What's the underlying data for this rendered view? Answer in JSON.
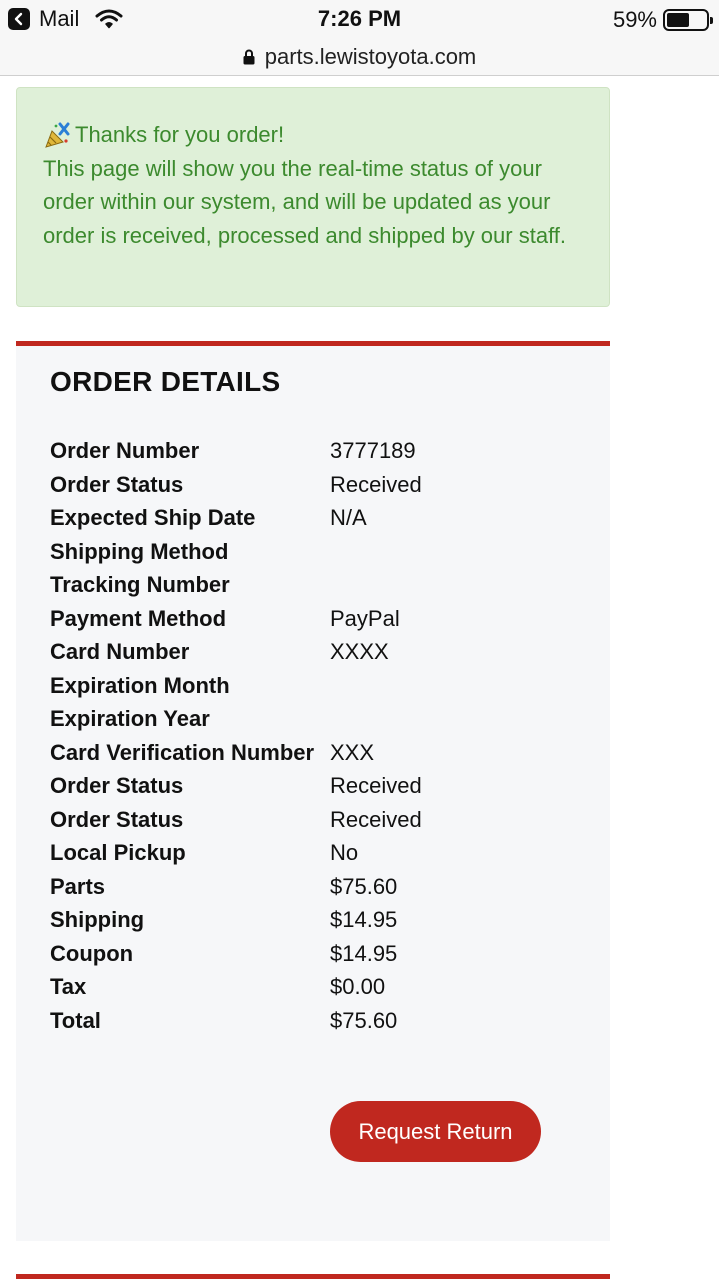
{
  "status_bar": {
    "back_app": "Mail",
    "time": "7:26 PM",
    "battery_percent_label": "59%",
    "battery_level": 0.59
  },
  "url_bar": {
    "url": "parts.lewistoyota.com"
  },
  "alert": {
    "line1": "Thanks for you order!",
    "body": "This page will show you the real-time status of your order within our system, and will be updated as your order is received, processed and shipped by our staff."
  },
  "order": {
    "title": "ORDER DETAILS",
    "rows": [
      {
        "label": "Order Number",
        "value": "3777189"
      },
      {
        "label": "Order Status",
        "value": "Received"
      },
      {
        "label": "Expected Ship Date",
        "value": "N/A"
      },
      {
        "label": "Shipping Method",
        "value": ""
      },
      {
        "label": "Tracking Number",
        "value": ""
      },
      {
        "label": "Payment Method",
        "value": "PayPal"
      },
      {
        "label": "Card Number",
        "value": "XXXX"
      },
      {
        "label": "Expiration Month",
        "value": ""
      },
      {
        "label": "Expiration Year",
        "value": ""
      },
      {
        "label": "Card Verification Number",
        "value": "XXX"
      },
      {
        "label": "Order Status",
        "value": "Received"
      },
      {
        "label": "Order Status",
        "value": "Received"
      },
      {
        "label": "Local Pickup",
        "value": "No"
      },
      {
        "label": "Parts",
        "value": "$75.60"
      },
      {
        "label": "Shipping",
        "value": "$14.95"
      },
      {
        "label": "Coupon",
        "value": "$14.95"
      },
      {
        "label": "Tax",
        "value": "$0.00"
      },
      {
        "label": "Total",
        "value": "$75.60"
      }
    ],
    "return_button": "Request Return"
  },
  "colors": {
    "accent_red": "#c0281f",
    "alert_bg": "#dff0d8",
    "alert_text": "#3c8a2e"
  }
}
